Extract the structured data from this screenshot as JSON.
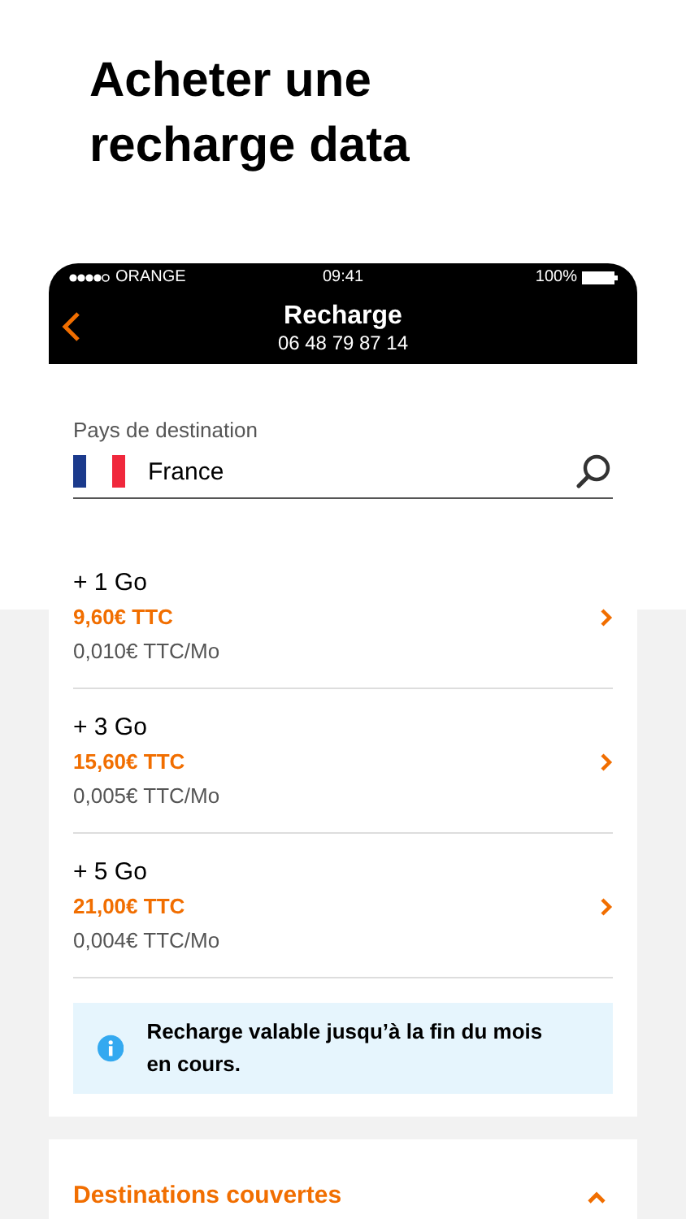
{
  "headline": "Acheter une recharge data",
  "status_bar": {
    "carrier": "ORANGE",
    "time": "09:41",
    "battery": "100%"
  },
  "nav": {
    "title": "Recharge",
    "subtitle": "06 48 79 87 14"
  },
  "destination": {
    "label": "Pays de destination",
    "value": "France"
  },
  "offers": [
    {
      "title": "+ 1 Go",
      "price": "9,60€ TTC",
      "unit_price": "0,010€ TTC/Mo"
    },
    {
      "title": "+ 3 Go",
      "price": "15,60€ TTC",
      "unit_price": "0,005€ TTC/Mo"
    },
    {
      "title": "+ 5 Go",
      "price": "21,00€ TTC",
      "unit_price": "0,004€ TTC/Mo"
    }
  ],
  "info": "Recharge valable jusqu’à la fin du mois en cours.",
  "section": {
    "title": "Destinations couvertes",
    "expanded": true
  }
}
